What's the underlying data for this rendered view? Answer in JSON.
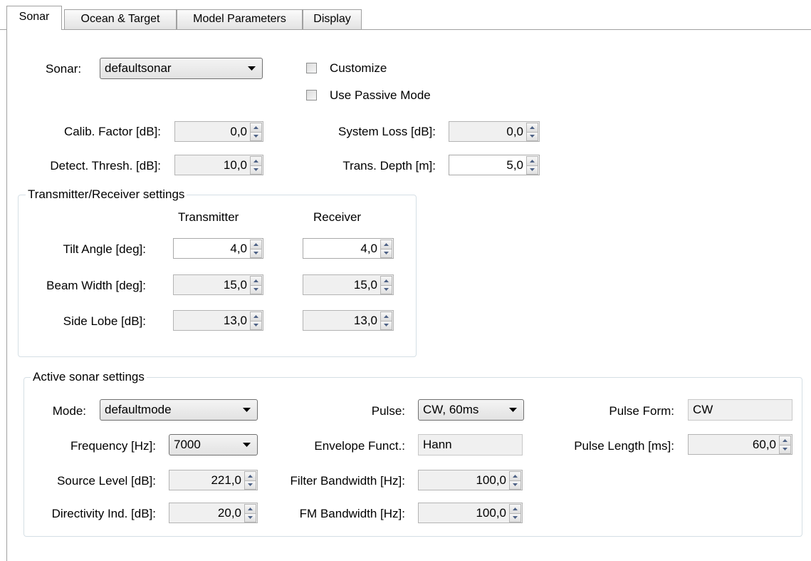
{
  "tabs": [
    "Sonar",
    "Ocean & Target",
    "Model Parameters",
    "Display"
  ],
  "sonar": {
    "label": "Sonar:",
    "selected": "defaultsonar",
    "customize_label": "Customize",
    "customize_checked": false,
    "passive_label": "Use Passive Mode",
    "passive_checked": false
  },
  "fields": {
    "calib_label": "Calib. Factor [dB]:",
    "calib_value": "0,0",
    "detect_label": "Detect. Thresh. [dB]:",
    "detect_value": "10,0",
    "sysloss_label": "System Loss [dB]:",
    "sysloss_value": "0,0",
    "transdepth_label": "Trans. Depth [m]:",
    "transdepth_value": "5,0"
  },
  "tr": {
    "title": "Transmitter/Receiver settings",
    "col_transmitter": "Transmitter",
    "col_receiver": "Receiver",
    "tilt_label": "Tilt Angle [deg]:",
    "tilt_tx": "4,0",
    "tilt_rx": "4,0",
    "beam_label": "Beam Width [deg]:",
    "beam_tx": "15,0",
    "beam_rx": "15,0",
    "side_label": "Side Lobe [dB]:",
    "side_tx": "13,0",
    "side_rx": "13,0"
  },
  "active": {
    "title": "Active sonar settings",
    "mode_label": "Mode:",
    "mode_value": "defaultmode",
    "freq_label": "Frequency [Hz]:",
    "freq_value": "7000",
    "srclvl_label": "Source Level [dB]:",
    "srclvl_value": "221,0",
    "dirind_label": "Directivity Ind. [dB]:",
    "dirind_value": "20,0",
    "pulse_label": "Pulse:",
    "pulse_value": "CW, 60ms",
    "env_label": "Envelope Funct.:",
    "env_value": "Hann",
    "filterbw_label": "Filter Bandwidth [Hz]:",
    "filterbw_value": "100,0",
    "fmbw_label": "FM Bandwidth [Hz]:",
    "fmbw_value": "100,0",
    "pform_label": "Pulse Form:",
    "pform_value": "CW",
    "plen_label": "Pulse Length [ms]:",
    "plen_value": "60,0"
  }
}
